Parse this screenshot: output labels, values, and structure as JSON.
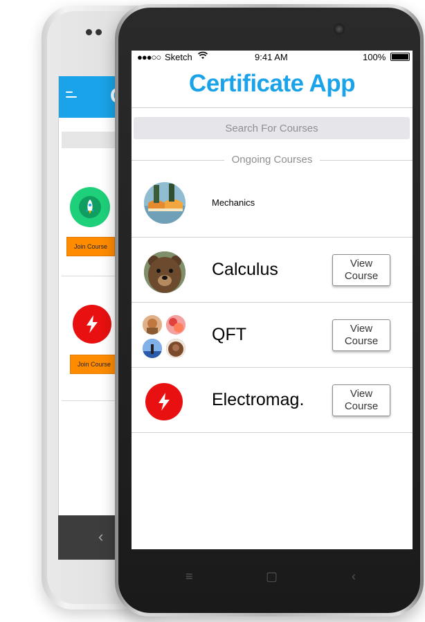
{
  "back_app": {
    "title_letter": "C",
    "join_buttons": [
      "Join Course",
      "Join Course"
    ],
    "colors": {
      "header": "#1aa3e8",
      "join": "#ff8c00",
      "icon_green": "#1fd07a",
      "icon_red": "#e81010"
    },
    "icons": [
      "menu-icon",
      "rocket-icon",
      "lightning-icon"
    ],
    "nav_back_glyph": "‹"
  },
  "status_bar": {
    "signal": "●●●○○",
    "carrier": "Sketch",
    "time": "9:41 AM",
    "battery": "100%"
  },
  "app": {
    "title": "Certificate App",
    "search_placeholder": "Search For Courses",
    "section_label": "Ongoing Courses",
    "accent_color": "#1aa3e8"
  },
  "courses": [
    {
      "name": "Mechanics",
      "button": "",
      "avatar": "shoes-photo"
    },
    {
      "name": "Calculus",
      "button": "View\nCourse",
      "avatar": "bear-photo"
    },
    {
      "name": "QFT",
      "button": "View\nCourse",
      "avatar": "group-photos"
    },
    {
      "name": "Electromag.",
      "button": "View\nCourse",
      "avatar": "lightning-icon"
    }
  ],
  "front_nav": {
    "menu": "≡",
    "home": "▢",
    "back": "‹"
  }
}
